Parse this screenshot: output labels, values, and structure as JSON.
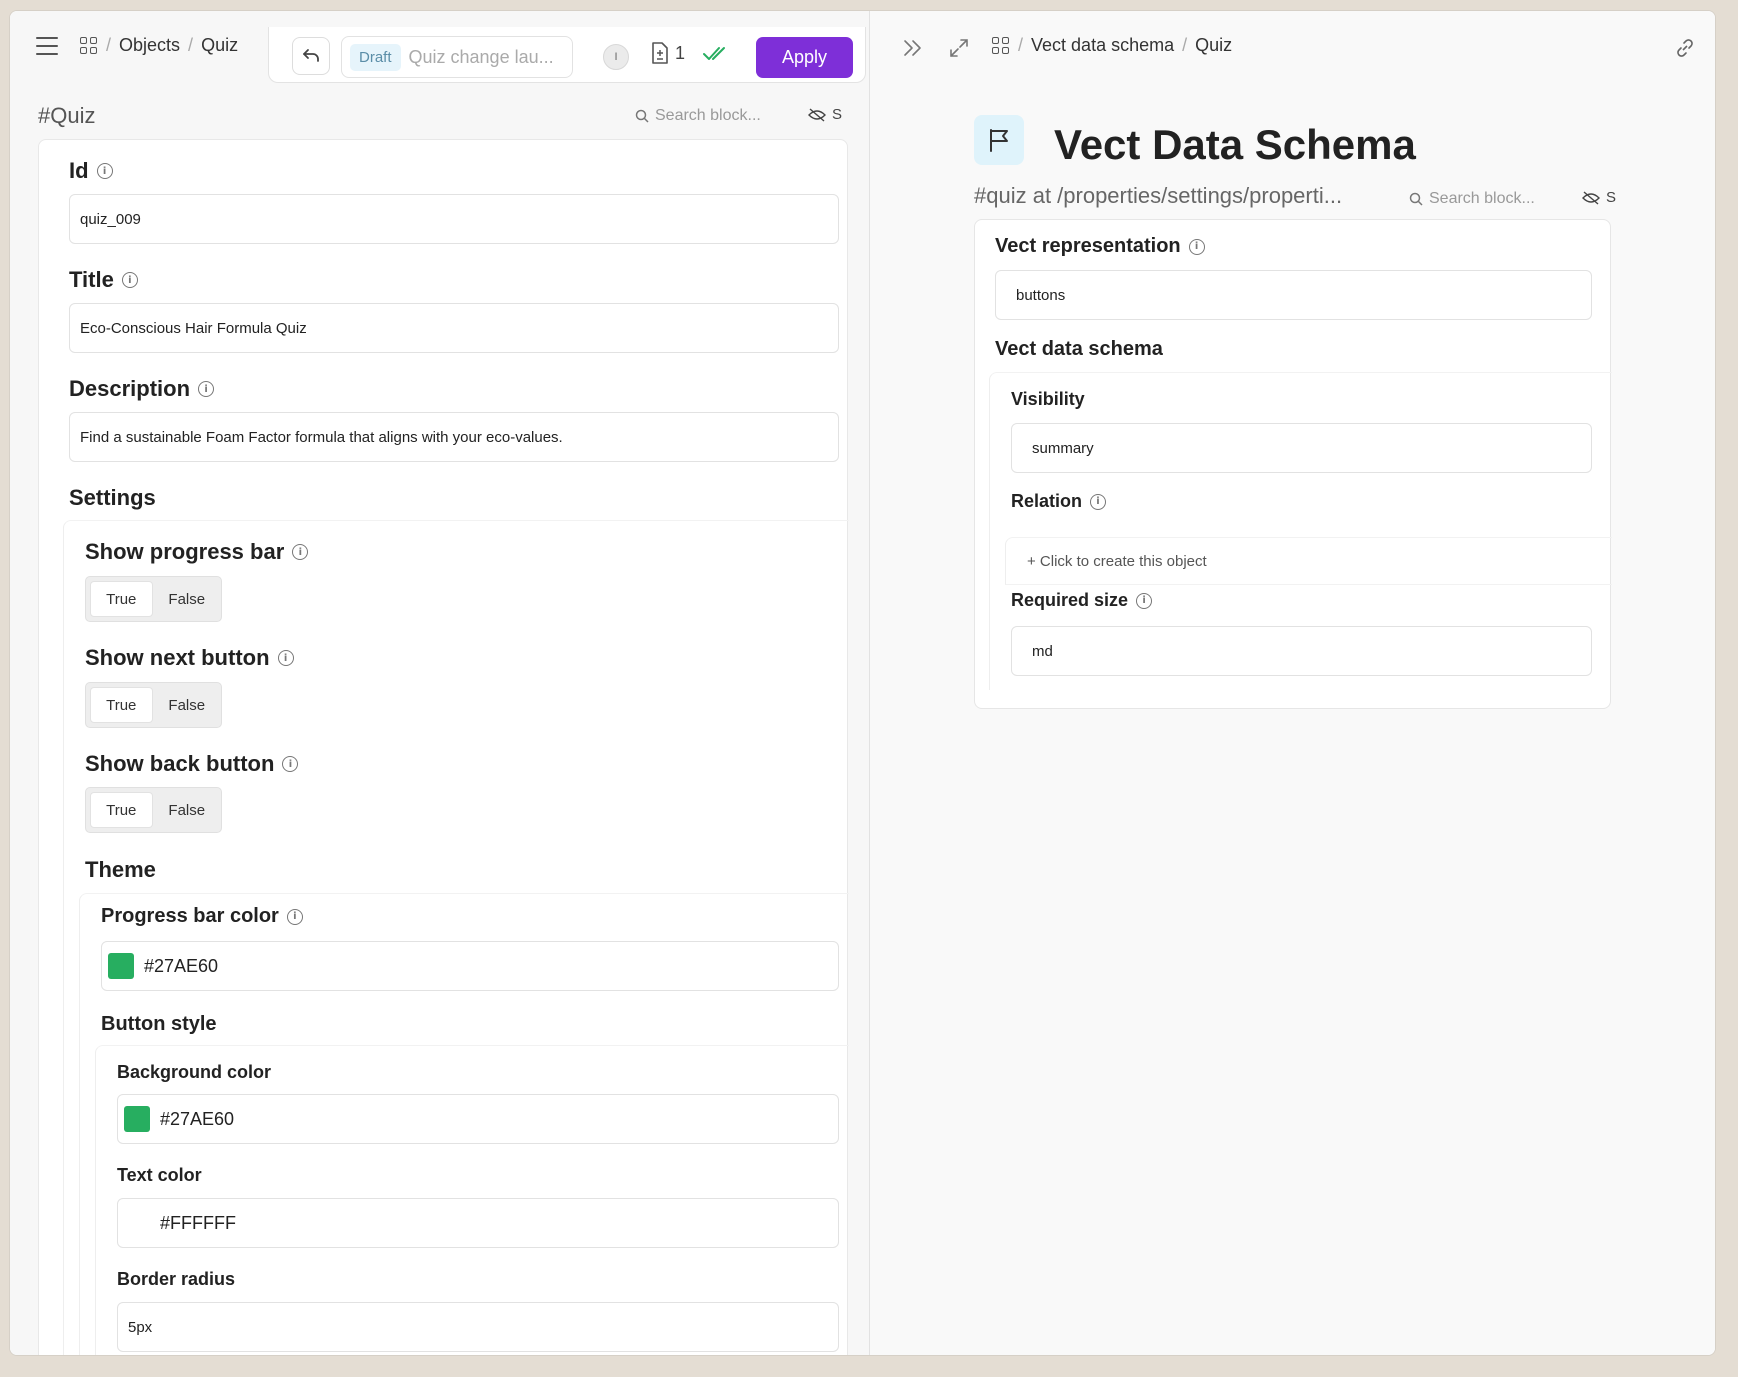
{
  "left": {
    "breadcrumb": [
      "Objects",
      "Quiz"
    ],
    "toolbar": {
      "draft_badge": "Draft",
      "draft_name": "Quiz change lau...",
      "avatar_initial": "I",
      "change_count": "1",
      "apply_label": "Apply"
    },
    "title": "#Quiz",
    "search_placeholder": "Search block...",
    "eye_label": "S",
    "fields": {
      "id_label": "Id",
      "id_value": "quiz_009",
      "title_label": "Title",
      "title_value": "Eco-Conscious Hair Formula Quiz",
      "description_label": "Description",
      "description_value": "Find a sustainable Foam Factor formula that aligns with your eco-values."
    },
    "settings": {
      "heading": "Settings",
      "show_progress_bar": "Show progress bar",
      "show_next_button": "Show next button",
      "show_back_button": "Show back button",
      "true_label": "True",
      "false_label": "False",
      "progress_bar_value": "True",
      "next_button_value": "True",
      "back_button_value": "True"
    },
    "theme": {
      "heading": "Theme",
      "progress_bar_color_label": "Progress bar color",
      "progress_bar_color": "#27AE60",
      "button_style_heading": "Button style",
      "background_color_label": "Background color",
      "background_color": "#27AE60",
      "text_color_label": "Text color",
      "text_color": "#FFFFFF",
      "border_radius_label": "Border radius",
      "border_radius": "5px"
    }
  },
  "right": {
    "breadcrumb": [
      "Vect data schema",
      "Quiz"
    ],
    "title": "Vect Data Schema",
    "path": "#quiz at /properties/settings/properti...",
    "search_placeholder": "Search block...",
    "eye_label": "S",
    "vect_representation_label": "Vect representation",
    "vect_representation_value": "buttons",
    "vect_data_schema_heading": "Vect data schema",
    "visibility_label": "Visibility",
    "visibility_value": "summary",
    "relation_label": "Relation",
    "relation_create": "+ Click to create this object",
    "required_size_label": "Required size",
    "required_size_value": "md"
  },
  "colors": {
    "accent": "#7E2FD8",
    "green": "#27AE60"
  }
}
